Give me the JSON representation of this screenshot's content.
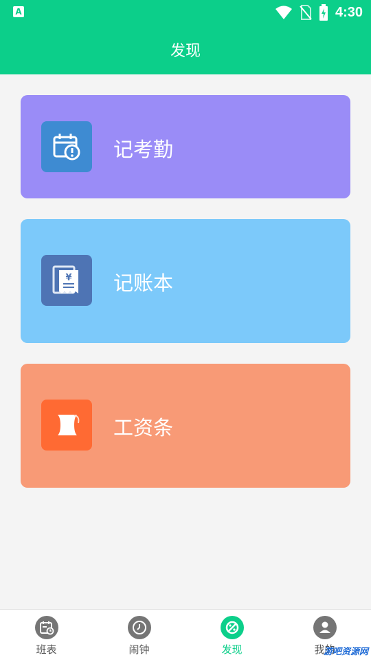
{
  "status_bar": {
    "time": "4:30",
    "left_icon_letter": "A"
  },
  "header": {
    "title": "发现"
  },
  "cards": [
    {
      "label": "记考勤",
      "bg": "#9a8cf7",
      "icon_bg": "#3e8bd2",
      "icon": "calendar-alert-icon"
    },
    {
      "label": "记账本",
      "bg": "#7cc9fa",
      "icon_bg": "#4e74b4",
      "icon": "receipt-yen-icon"
    },
    {
      "label": "工资条",
      "bg": "#f89a76",
      "icon_bg": "#ff6a33",
      "icon": "scroll-icon"
    }
  ],
  "tabs": [
    {
      "label": "班表",
      "icon": "schedule-icon",
      "active": false
    },
    {
      "label": "闹钟",
      "icon": "clock-icon",
      "active": false
    },
    {
      "label": "发现",
      "icon": "discover-icon",
      "active": true
    },
    {
      "label": "我的",
      "icon": "person-icon",
      "active": false
    }
  ],
  "watermark": "游吧资源网",
  "colors": {
    "primary": "#0ccf8a",
    "background": "#f4f4f4"
  }
}
